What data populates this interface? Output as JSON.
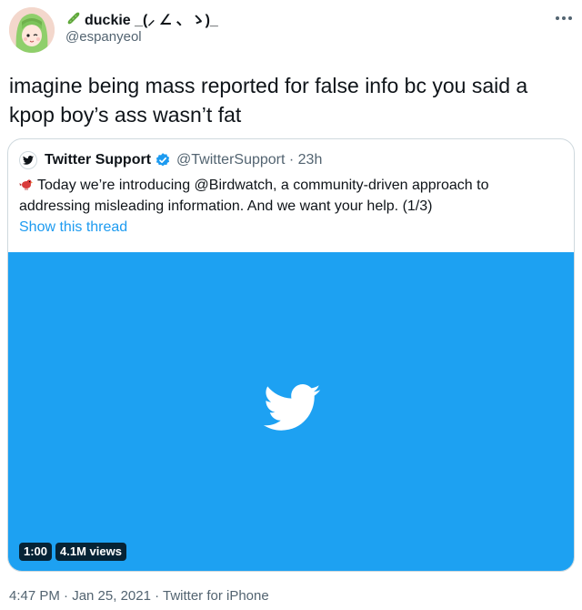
{
  "author": {
    "display_name": "duckie _(⸝ ∠ 、ゝ)_",
    "handle": "@espanyeol",
    "emoji_icon": "cucumber-icon"
  },
  "tweet": {
    "text": "imagine being mass reported for false info bc you said a kpop boy’s ass wasn’t fat"
  },
  "quote": {
    "name": "Twitter Support",
    "handle_time": "@TwitterSupport · 23h",
    "text": "Today we’re introducing @Birdwatch, a community-driven approach to addressing misleading information. And we want your help. (1/3)",
    "thread_link": "Show this thread",
    "video": {
      "duration": "1:00",
      "views": "4.1M views",
      "background_color": "#1da1f2"
    }
  },
  "meta": {
    "timestamp": "4:47 PM · Jan 25, 2021 · Twitter for iPhone"
  }
}
